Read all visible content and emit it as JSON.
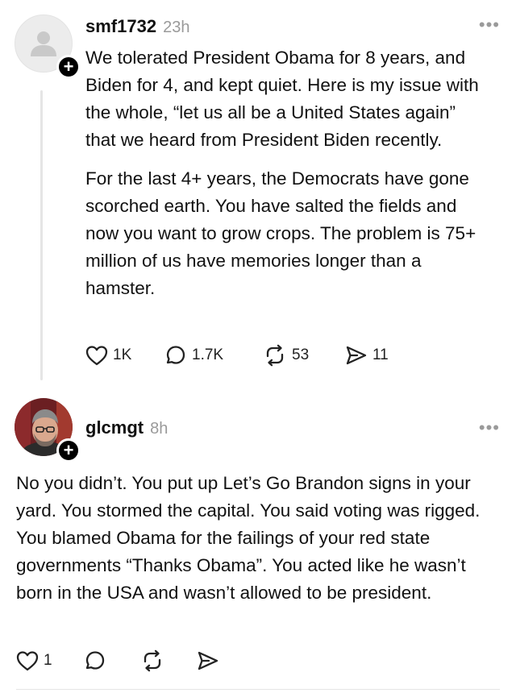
{
  "post1": {
    "username": "smf1732",
    "time": "23h",
    "more_label": "•••",
    "plus_label": "+",
    "paragraphs": [
      "We tolerated President Obama for 8 years, and Biden for 4, and kept quiet.  Here is my issue with the whole, “let us all be a United States again” that we heard from President Biden recently.",
      "For the last 4+ years, the Democrats have gone scorched earth. You have salted the fields and now you want to grow crops.  The problem is 75+ million of us have memories longer than a hamster."
    ],
    "likes": "1K",
    "replies": "1.7K",
    "reposts": "53",
    "shares": "11"
  },
  "post2": {
    "username": "glcmgt",
    "time": "8h",
    "more_label": "•••",
    "plus_label": "+",
    "text": "No you didn’t.  You put up Let’s Go Brandon signs in your yard.  You stormed the capital.  You said voting was rigged.  You blamed Obama for the failings of your red state governments “Thanks Obama”. You acted like he wasn’t born in the USA and wasn’t allowed to be president.",
    "likes": "1"
  },
  "icons": {
    "like": "heart-icon",
    "reply": "comment-bubble-icon",
    "repost": "repost-arrows-icon",
    "share": "send-icon",
    "more": "more-dots-icon",
    "follow": "plus-icon",
    "avatar_placeholder": "person-silhouette-icon"
  }
}
